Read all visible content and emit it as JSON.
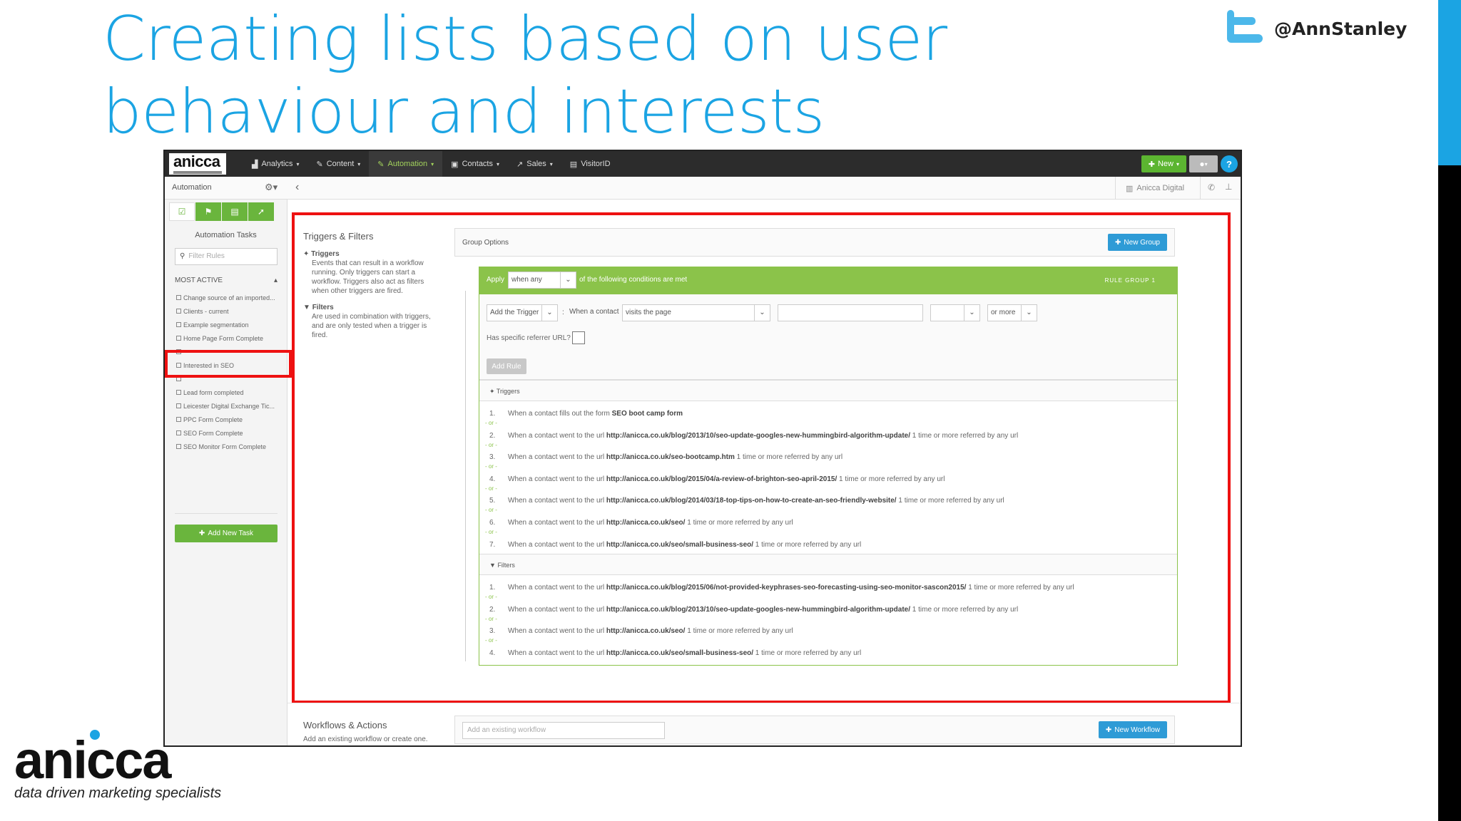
{
  "slide": {
    "title": "Creating lists based on user behaviour and interests",
    "twitter_handle": "@AnnStanley",
    "footer_logo": "anicca",
    "footer_tagline": "data driven marketing specialists",
    "accent_color": "#1ba4e3",
    "highlight_color": "#ee1111"
  },
  "app": {
    "logo": "anicca",
    "nav": [
      {
        "label": "Analytics",
        "icon": "bar-chart-icon"
      },
      {
        "label": "Content",
        "icon": "pencil-icon"
      },
      {
        "label": "Automation",
        "icon": "wand-icon",
        "active": true
      },
      {
        "label": "Contacts",
        "icon": "contact-card-icon"
      },
      {
        "label": "Sales",
        "icon": "trend-icon"
      },
      {
        "label": "VisitorID",
        "icon": "building-icon"
      }
    ],
    "new_button": "New",
    "subbar_title": "Automation",
    "company": "Anicca Digital"
  },
  "sidebar": {
    "heading": "Automation Tasks",
    "filter_placeholder": "Filter Rules",
    "most_active": "MOST ACTIVE",
    "items": [
      "Change source of an imported...",
      "Clients - current",
      "Example segmentation",
      "Home Page Form Complete",
      "",
      "Interested in SEO",
      "",
      "Lead form completed",
      "Leicester Digital Exchange Tic...",
      "PPC Form Complete",
      "SEO Form Complete",
      "SEO Monitor Form Complete"
    ],
    "add_task": "Add New Task"
  },
  "main": {
    "heading": "Triggers & Filters",
    "triggers_title": "Triggers",
    "triggers_desc": "Events that can result in a workflow running. Only triggers can start a workflow. Triggers also act as filters when other triggers are fired.",
    "filters_title": "Filters",
    "filters_desc": "Are used in combination with triggers, and are only tested when a trigger is fired.",
    "group_options": "Group Options",
    "new_group": "New Group",
    "rule_group": {
      "apply": "Apply",
      "when_any": "when any",
      "conditions": "of the following conditions are met",
      "label": "RULE GROUP 1",
      "add_trigger": "Add the Trigger",
      "when_contact": "When a contact",
      "visits_page": "visits the page",
      "or_more": "or more",
      "referrer": "Has specific referrer URL?",
      "add_rule": "Add Rule"
    },
    "triggers_section": "Triggers",
    "filters_section": "Filters",
    "or_separator": "- or -",
    "triggers": [
      {
        "pre": "When a contact fills out the form ",
        "bold": "SEO boot camp form",
        "post": ""
      },
      {
        "pre": "When a contact went to the url ",
        "bold": "http://anicca.co.uk/blog/2013/10/seo-update-googles-new-hummingbird-algorithm-update/",
        "post": " 1 time or more referred by any url"
      },
      {
        "pre": "When a contact went to the url ",
        "bold": "http://anicca.co.uk/seo-bootcamp.htm",
        "post": " 1 time or more referred by any url"
      },
      {
        "pre": "When a contact went to the url ",
        "bold": "http://anicca.co.uk/blog/2015/04/a-review-of-brighton-seo-april-2015/",
        "post": " 1 time or more referred by any url"
      },
      {
        "pre": "When a contact went to the url ",
        "bold": "http://anicca.co.uk/blog/2014/03/18-top-tips-on-how-to-create-an-seo-friendly-website/",
        "post": " 1 time or more referred by any url"
      },
      {
        "pre": "When a contact went to the url ",
        "bold": "http://anicca.co.uk/seo/",
        "post": " 1 time or more referred by any url"
      },
      {
        "pre": "When a contact went to the url ",
        "bold": "http://anicca.co.uk/seo/small-business-seo/",
        "post": " 1 time or more referred by any url"
      }
    ],
    "filters": [
      {
        "pre": "When a contact went to the url ",
        "bold": "http://anicca.co.uk/blog/2015/06/not-provided-keyphrases-seo-forecasting-using-seo-monitor-sascon2015/",
        "post": " 1 time or more referred by any url"
      },
      {
        "pre": "When a contact went to the url ",
        "bold": "http://anicca.co.uk/blog/2013/10/seo-update-googles-new-hummingbird-algorithm-update/",
        "post": " 1 time or more referred by any url"
      },
      {
        "pre": "When a contact went to the url ",
        "bold": "http://anicca.co.uk/seo/",
        "post": " 1 time or more referred by any url"
      },
      {
        "pre": "When a contact went to the url ",
        "bold": "http://anicca.co.uk/seo/small-business-seo/",
        "post": " 1 time or more referred by any url"
      }
    ],
    "workflows_heading": "Workflows & Actions",
    "workflows_sub": "Add an existing workflow or create one.",
    "workflow_placeholder": "Add an existing workflow",
    "new_workflow": "New Workflow"
  }
}
